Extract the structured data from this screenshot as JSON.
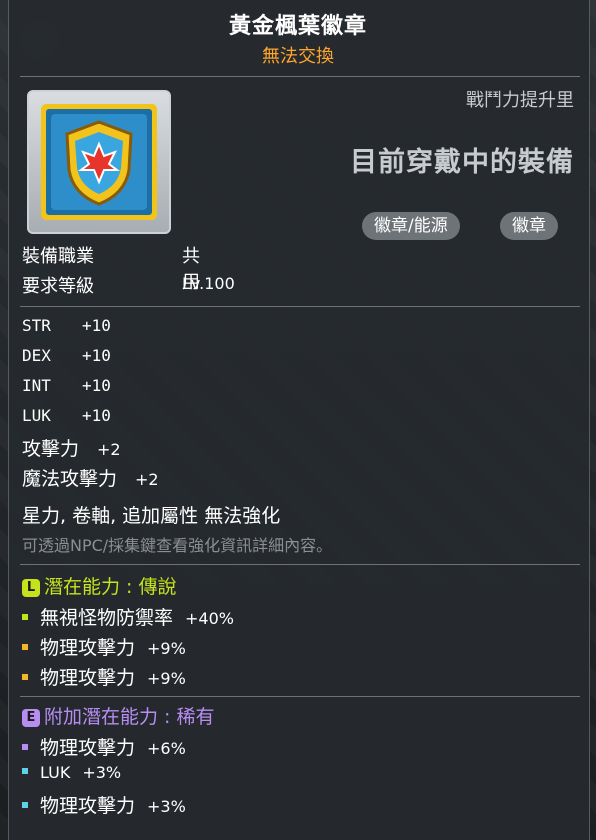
{
  "item": {
    "name": "黃金楓葉徽章",
    "trade_status": "無法交換",
    "cp_label": "戰鬥力提升里",
    "equipped_text": "目前穿戴中的裝備",
    "tags": [
      "徽章/能源",
      "徽章"
    ]
  },
  "requirements": [
    {
      "label": "裝備職業",
      "value": "共用"
    },
    {
      "label": "要求等級",
      "value": "Lv.100"
    }
  ],
  "stats": [
    {
      "label": "STR",
      "value": "+10"
    },
    {
      "label": "DEX",
      "value": "+10"
    },
    {
      "label": "INT",
      "value": "+10"
    },
    {
      "label": "LUK",
      "value": "+10"
    }
  ],
  "attack": [
    {
      "label": "攻擊力",
      "value": "+2"
    },
    {
      "label": "魔法攻擊力",
      "value": "+2"
    }
  ],
  "enhance_note": "星力, 卷軸, 追加屬性 無法強化",
  "hint": "可透過NPC/採集鍵查看強化資訊詳細內容。",
  "potential": {
    "badge": "L",
    "title": "潛在能力 : 傳說",
    "color": "#c6e21a",
    "lines": [
      {
        "label": "無視怪物防禦率",
        "value": "+40%"
      },
      {
        "label": "物理攻擊力",
        "value": "+9%"
      },
      {
        "label": "物理攻擊力",
        "value": "+9%"
      }
    ]
  },
  "additional": {
    "badge": "E",
    "title": "附加潛在能力 : 稀有",
    "color": "#b78df2",
    "lines": [
      {
        "label": "物理攻擊力",
        "value": "+6%",
        "dot": "#b78df2"
      },
      {
        "label": "LUK",
        "value": "+3%",
        "dot": "#5fd1e6"
      },
      {
        "label": "物理攻擊力",
        "value": "+3%",
        "dot": "#5fd1e6"
      }
    ]
  }
}
